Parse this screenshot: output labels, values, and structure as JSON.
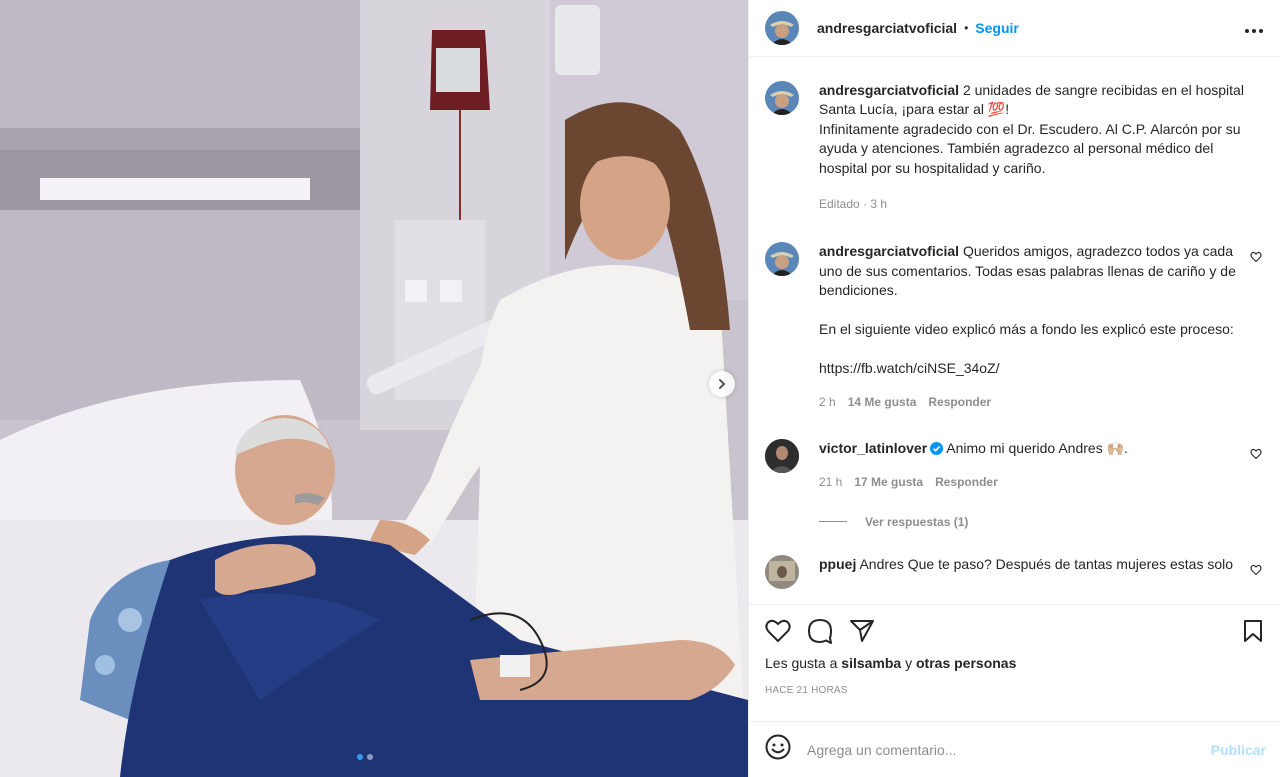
{
  "post": {
    "username": "andresgarciatvoficial",
    "separator": "•",
    "follow_label": "Seguir",
    "more_label": "•••"
  },
  "comments": [
    {
      "username": "andresgarciatvoficial",
      "text": "2 unidades de sangre recibidas en el hospital Santa Lucía, ¡para estar al 💯!\nInfinitamente agradecido con el Dr. Escudero. Al C.P. Alarcón por su ayuda y atenciones. También agradezco al personal médico del hospital por su hospitalidad y cariño.",
      "meta": "Editado · 3 h"
    },
    {
      "username": "andresgarciatvoficial",
      "text": "Queridos amigos, agradezco todos ya cada uno de sus comentarios. Todas esas palabras llenas de cariño y de bendiciones.\n\nEn el siguiente video explicó más a fondo les explicó este proceso:\n\nhttps://fb.watch/ciNSE_34oZ/",
      "time": "2 h",
      "likes": "14 Me gusta",
      "reply": "Responder"
    },
    {
      "username": "victor_latinlover",
      "text": "Animo mi querido Andres 🙌🏼.",
      "time": "21 h",
      "likes": "17 Me gusta",
      "reply": "Responder",
      "view_replies": "Ver respuestas (1)"
    },
    {
      "username": "ppuej",
      "text": "Andres Que te paso? Después de tantas mujeres estas solo"
    }
  ],
  "likes": {
    "prefix": "Les gusta a",
    "user": "silsamba",
    "conj": "y",
    "others": "otras personas"
  },
  "timestamp": "HACE 21 HORAS",
  "add_comment": {
    "placeholder": "Agrega un comentario...",
    "publish_label": "Publicar"
  },
  "carousel": {
    "slides": 2,
    "active": 0
  },
  "colors": {
    "accent": "#0095f6",
    "muted": "#8e8e8e",
    "publish_disabled": "#b2dffc",
    "text": "#262626"
  },
  "icons": [
    "more-icon",
    "heart-icon",
    "comment-icon",
    "share-icon",
    "save-icon",
    "emoji-icon",
    "chevron-right-icon",
    "verified-icon"
  ]
}
